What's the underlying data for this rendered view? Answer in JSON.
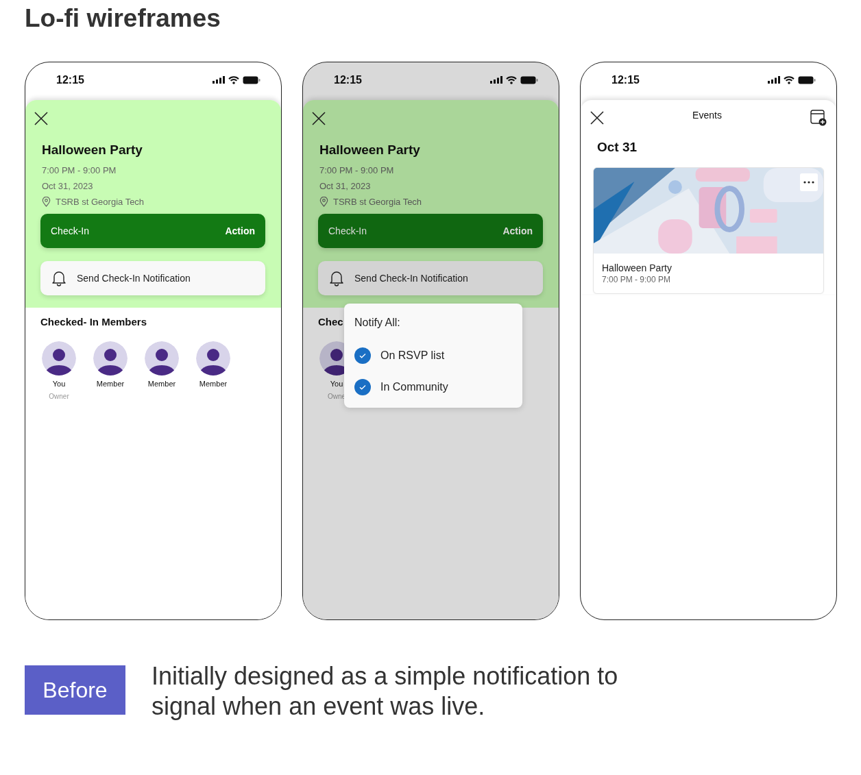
{
  "page_title": "Lo-fi wireframes",
  "phones": [
    {
      "kind": "event_detail",
      "dimmed": false,
      "time": "12:15",
      "title": "Halloween Party",
      "time_range": "7:00 PM - 9:00 PM",
      "date": "Oct 31, 2023",
      "location": "TSRB st Georgia Tech",
      "checkin": {
        "label": "Check-In",
        "action": "Action"
      },
      "notify_button": "Send Check-In Notification",
      "members_heading": "Checked- In Members",
      "members": [
        {
          "name": "You",
          "role": "Owner"
        },
        {
          "name": "Member"
        },
        {
          "name": "Member"
        },
        {
          "name": "Member"
        }
      ]
    },
    {
      "kind": "event_detail",
      "dimmed": true,
      "time": "12:15",
      "title": "Halloween Party",
      "time_range": "7:00 PM - 9:00 PM",
      "date": "Oct 31, 2023",
      "location": "TSRB st Georgia Tech",
      "checkin": {
        "label": "Check-In",
        "action": "Action"
      },
      "notify_button": "Send Check-In Notification",
      "members_heading": "Chec",
      "members": [
        {
          "name": "You",
          "role": "Owne"
        }
      ],
      "popup": {
        "title": "Notify All:",
        "options": [
          {
            "label": "On RSVP list",
            "checked": true
          },
          {
            "label": "In Community",
            "checked": true
          }
        ]
      }
    },
    {
      "kind": "events_list",
      "time": "12:15",
      "header": "Events",
      "date_heading": "Oct 31",
      "events": [
        {
          "title": "Halloween Party",
          "time_range": "7:00 PM - 9:00 PM"
        }
      ]
    }
  ],
  "badge": "Before",
  "caption": "Initially designed as a simple notification to signal when an event was live."
}
